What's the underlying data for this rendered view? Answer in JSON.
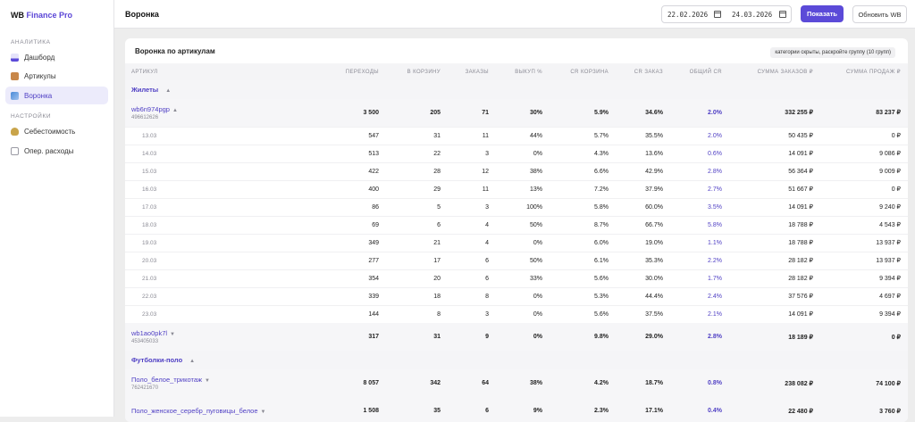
{
  "app": {
    "brand_main": "WB",
    "brand_accent": "Finance Pro"
  },
  "sidebar": {
    "analytics_label": "АНАЛИТИКА",
    "settings_label": "НАСТРОЙКИ",
    "items": [
      {
        "label": "Дашборд",
        "icon": "chart-icon",
        "color": "#5b4ad8"
      },
      {
        "label": "Артикулы",
        "icon": "box-icon",
        "color": "#c8874a"
      },
      {
        "label": "Воронка",
        "icon": "funnel-chart-icon",
        "color": "#4a8ad8",
        "active": true
      },
      {
        "label": "Себестоимость",
        "icon": "money-bag-icon",
        "color": "#c9a44a"
      },
      {
        "label": "Опер. расходы",
        "icon": "receipt-icon",
        "color": "#9a9aa4"
      }
    ]
  },
  "header": {
    "title": "Воронка",
    "date_from": "22.02.2026",
    "date_to": "24.03.2026",
    "show_label": "Показать",
    "refresh_label": "Обновить WB"
  },
  "card": {
    "title": "Воронка по артикулам",
    "badge": "категории скрыты, раскройте группу (10 групп)"
  },
  "table": {
    "columns": [
      "АРТИКУЛ",
      "ПЕРЕХОДЫ",
      "В КОРЗИНУ",
      "ЗАКАЗЫ",
      "ВЫКУП %",
      "CR КОРЗИНА",
      "CR ЗАКАЗ",
      "ОБЩИЙ CR",
      "СУММА ЗАКАЗОВ ₽",
      "СУММА ПРОДАЖ ₽"
    ],
    "rows": [
      {
        "type": "group",
        "name": "Жилеты",
        "toggle": "▲"
      },
      {
        "type": "article",
        "name": "wb6n974pgp",
        "id": "496612626",
        "toggle": "▲",
        "cells": [
          "3 500",
          "205",
          "71",
          "30%",
          "5.9%",
          "34.6%",
          "2.0%",
          "332 255 ₽",
          "83 237 ₽"
        ]
      },
      {
        "type": "day",
        "date": "13.03",
        "cells": [
          "547",
          "31",
          "11",
          "44%",
          "5.7%",
          "35.5%",
          "2.0%",
          "50 435 ₽",
          "0 ₽"
        ]
      },
      {
        "type": "day",
        "date": "14.03",
        "cells": [
          "513",
          "22",
          "3",
          "0%",
          "4.3%",
          "13.6%",
          "0.6%",
          "14 091 ₽",
          "9 086 ₽"
        ]
      },
      {
        "type": "day",
        "date": "15.03",
        "cells": [
          "422",
          "28",
          "12",
          "38%",
          "6.6%",
          "42.9%",
          "2.8%",
          "56 364 ₽",
          "9 009 ₽"
        ]
      },
      {
        "type": "day",
        "date": "16.03",
        "cells": [
          "400",
          "29",
          "11",
          "13%",
          "7.2%",
          "37.9%",
          "2.7%",
          "51 667 ₽",
          "0 ₽"
        ]
      },
      {
        "type": "day",
        "date": "17.03",
        "cells": [
          "86",
          "5",
          "3",
          "100%",
          "5.8%",
          "60.0%",
          "3.5%",
          "14 091 ₽",
          "9 240 ₽"
        ]
      },
      {
        "type": "day",
        "date": "18.03",
        "cells": [
          "69",
          "6",
          "4",
          "50%",
          "8.7%",
          "66.7%",
          "5.8%",
          "18 788 ₽",
          "4 543 ₽"
        ]
      },
      {
        "type": "day",
        "date": "19.03",
        "cells": [
          "349",
          "21",
          "4",
          "0%",
          "6.0%",
          "19.0%",
          "1.1%",
          "18 788 ₽",
          "13 937 ₽"
        ]
      },
      {
        "type": "day",
        "date": "20.03",
        "cells": [
          "277",
          "17",
          "6",
          "50%",
          "6.1%",
          "35.3%",
          "2.2%",
          "28 182 ₽",
          "13 937 ₽"
        ]
      },
      {
        "type": "day",
        "date": "21.03",
        "cells": [
          "354",
          "20",
          "6",
          "33%",
          "5.6%",
          "30.0%",
          "1.7%",
          "28 182 ₽",
          "9 394 ₽"
        ]
      },
      {
        "type": "day",
        "date": "22.03",
        "cells": [
          "339",
          "18",
          "8",
          "0%",
          "5.3%",
          "44.4%",
          "2.4%",
          "37 576 ₽",
          "4 697 ₽"
        ]
      },
      {
        "type": "day",
        "date": "23.03",
        "cells": [
          "144",
          "8",
          "3",
          "0%",
          "5.6%",
          "37.5%",
          "2.1%",
          "14 091 ₽",
          "9 394 ₽"
        ]
      },
      {
        "type": "article",
        "name": "wb1ao0pk7l",
        "id": "453405033",
        "toggle": "▼",
        "cells": [
          "317",
          "31",
          "9",
          "0%",
          "9.8%",
          "29.0%",
          "2.8%",
          "18 189 ₽",
          "0 ₽"
        ]
      },
      {
        "type": "group",
        "name": "Футболки-поло",
        "toggle": "▲"
      },
      {
        "type": "article",
        "name": "Поло_белое_трикотаж",
        "id": "762421670",
        "toggle": "▼",
        "cells": [
          "8 057",
          "342",
          "64",
          "38%",
          "4.2%",
          "18.7%",
          "0.8%",
          "238 082 ₽",
          "74 100 ₽"
        ]
      },
      {
        "type": "article",
        "name": "Поло_женское_серебр_пуговицы_белое",
        "id": "",
        "toggle": "▼",
        "cells": [
          "1 508",
          "35",
          "6",
          "9%",
          "2.3%",
          "17.1%",
          "0.4%",
          "22 480 ₽",
          "3 760 ₽"
        ]
      }
    ]
  }
}
